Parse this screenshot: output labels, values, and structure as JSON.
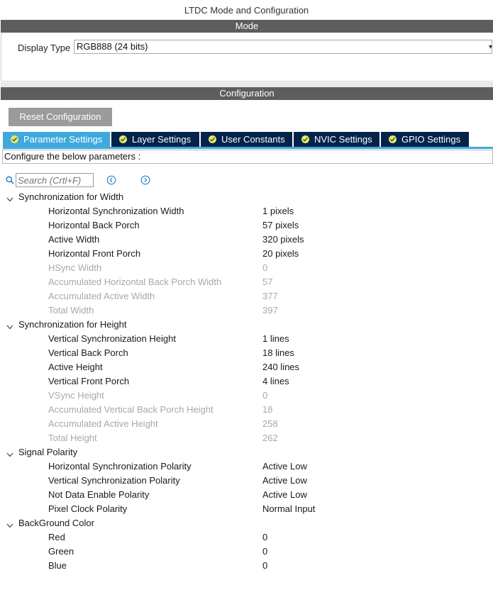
{
  "window": {
    "title": "LTDC Mode and Configuration"
  },
  "mode": {
    "header": "Mode",
    "display_type_label": "Display Type",
    "display_type_value": "RGB888 (24 bits)"
  },
  "config": {
    "header": "Configuration",
    "reset_label": "Reset Configuration",
    "tabs": [
      {
        "label": "Parameter Settings",
        "active": true
      },
      {
        "label": "Layer Settings",
        "active": false
      },
      {
        "label": "User Constants",
        "active": false
      },
      {
        "label": "NVIC Settings",
        "active": false
      },
      {
        "label": "GPIO Settings",
        "active": false
      }
    ],
    "configure_text": "Configure the below parameters :",
    "search_placeholder": "Search (Crtl+F)"
  },
  "groups": [
    {
      "title": "Synchronization for Width",
      "params": [
        {
          "name": "Horizontal Synchronization Width",
          "value": "1 pixels",
          "disabled": false
        },
        {
          "name": "Horizontal Back Porch",
          "value": "57 pixels",
          "disabled": false
        },
        {
          "name": "Active Width",
          "value": "320 pixels",
          "disabled": false
        },
        {
          "name": "Horizontal Front Porch",
          "value": "20 pixels",
          "disabled": false
        },
        {
          "name": "HSync Width",
          "value": "0",
          "disabled": true
        },
        {
          "name": "Accumulated Horizontal Back Porch Width",
          "value": "57",
          "disabled": true
        },
        {
          "name": "Accumulated Active Width",
          "value": "377",
          "disabled": true
        },
        {
          "name": "Total Width",
          "value": "397",
          "disabled": true
        }
      ]
    },
    {
      "title": "Synchronization for Height",
      "params": [
        {
          "name": "Vertical Synchronization Height",
          "value": "1 lines",
          "disabled": false
        },
        {
          "name": "Vertical Back Porch",
          "value": "18 lines",
          "disabled": false
        },
        {
          "name": "Active Height",
          "value": "240 lines",
          "disabled": false
        },
        {
          "name": "Vertical Front Porch",
          "value": "4 lines",
          "disabled": false
        },
        {
          "name": "VSync Height",
          "value": "0",
          "disabled": true
        },
        {
          "name": "Accumulated Vertical Back Porch Height",
          "value": "18",
          "disabled": true
        },
        {
          "name": "Accumulated Active Height",
          "value": "258",
          "disabled": true
        },
        {
          "name": "Total Height",
          "value": "262",
          "disabled": true
        }
      ]
    },
    {
      "title": "Signal Polarity",
      "params": [
        {
          "name": "Horizontal Synchronization Polarity",
          "value": "Active Low",
          "disabled": false
        },
        {
          "name": "Vertical Synchronization Polarity",
          "value": "Active Low",
          "disabled": false
        },
        {
          "name": "Not Data Enable Polarity",
          "value": "Active Low",
          "disabled": false
        },
        {
          "name": "Pixel Clock Polarity",
          "value": "Normal Input",
          "disabled": false
        }
      ]
    },
    {
      "title": "BackGround Color",
      "params": [
        {
          "name": "Red",
          "value": "0",
          "disabled": false
        },
        {
          "name": "Green",
          "value": "0",
          "disabled": false
        },
        {
          "name": "Blue",
          "value": "0",
          "disabled": false
        }
      ]
    }
  ],
  "colors": {
    "header_bar": "#5d5d5d",
    "tab_bg": "#03234b",
    "tab_active": "#3fa9dd",
    "tab_check": "#e8e66a",
    "disabled_text": "#a8a8a8"
  },
  "icons": {
    "search": "search-icon",
    "prev": "circle-arrow-left-icon",
    "next": "circle-arrow-right-icon",
    "expand": "chevron-down-icon",
    "tab_status": "check-circle-icon"
  }
}
